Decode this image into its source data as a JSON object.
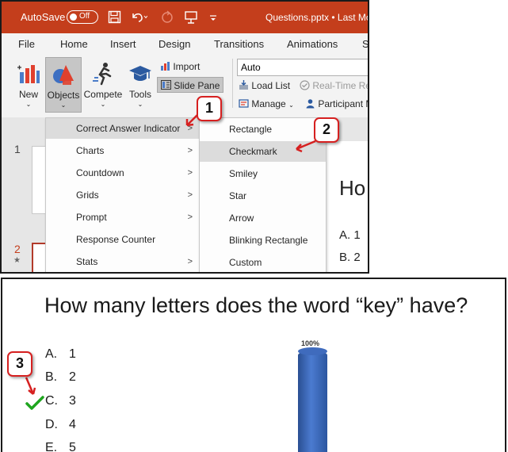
{
  "titlebar": {
    "autosave_label": "AutoSave",
    "autosave_state": "Off",
    "filename": "Questions.pptx  •  Last Mo"
  },
  "tabs": [
    "File",
    "Home",
    "Insert",
    "Design",
    "Transitions",
    "Animations",
    "S"
  ],
  "ribbon": {
    "new_label": "New",
    "objects_label": "Objects",
    "compete_label": "Compete",
    "tools_label": "Tools",
    "import_label": "Import",
    "slide_pane_label": "Slide Pane",
    "auto_value": "Auto",
    "load_list_label": "Load List",
    "realtime_label": "Real-Time Re",
    "manage_label": "Manage",
    "participant_label": "Participant M"
  },
  "slide_thumbs": [
    "1",
    "2"
  ],
  "slide_preview": {
    "heading": "Ho",
    "options": [
      "A.  1",
      "B.  2"
    ]
  },
  "objects_menu": [
    {
      "label": "Correct Answer Indicator",
      "submenu": true
    },
    {
      "label": "Charts",
      "submenu": true
    },
    {
      "label": "Countdown",
      "submenu": true
    },
    {
      "label": "Grids",
      "submenu": true
    },
    {
      "label": "Prompt",
      "submenu": true
    },
    {
      "label": "Response Counter",
      "submenu": false
    },
    {
      "label": "Stats",
      "submenu": true
    }
  ],
  "indicator_menu": [
    "Rectangle",
    "Checkmark",
    "Smiley",
    "Star",
    "Arrow",
    "Blinking Rectangle",
    "Custom"
  ],
  "callouts": [
    "1",
    "2",
    "3"
  ],
  "question": {
    "title": "How many letters does the word “key” have?",
    "answers": [
      {
        "key": "A.",
        "value": "1"
      },
      {
        "key": "B.",
        "value": "2"
      },
      {
        "key": "C.",
        "value": "3"
      },
      {
        "key": "D.",
        "value": "4"
      },
      {
        "key": "E.",
        "value": "5"
      }
    ],
    "bar_label": "100%",
    "bar_percent": 100
  },
  "colors": {
    "title_bar": "#c43e1c",
    "callout_border": "#d62020",
    "checkmark": "#1fa51f",
    "bar": "#3f6bbd"
  }
}
